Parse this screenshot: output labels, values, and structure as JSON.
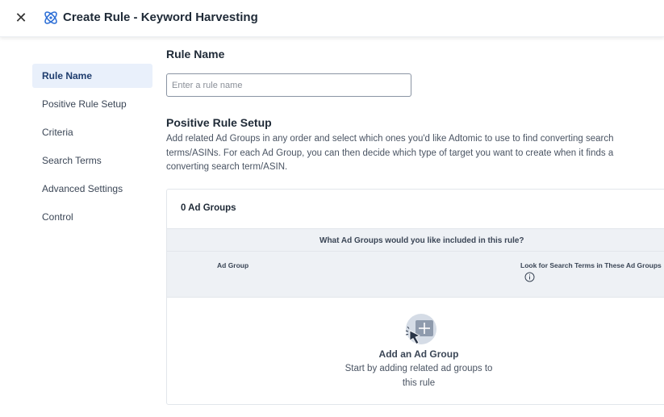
{
  "header": {
    "title": "Create Rule - Keyword Harvesting",
    "close_icon": "close-icon",
    "logo_icon": "adtomic-logo-icon"
  },
  "sidebar": {
    "items": [
      {
        "label": "Rule Name",
        "active": true
      },
      {
        "label": "Positive Rule Setup",
        "active": false
      },
      {
        "label": "Criteria",
        "active": false
      },
      {
        "label": "Search Terms",
        "active": false
      },
      {
        "label": "Advanced Settings",
        "active": false
      },
      {
        "label": "Control",
        "active": false
      }
    ]
  },
  "rule_name": {
    "heading": "Rule Name",
    "input_value": "",
    "placeholder": "Enter a rule name"
  },
  "positive_rule_setup": {
    "heading": "Positive Rule Setup",
    "description": "Add related Ad Groups in any order and select which ones you'd like Adtomic to use to find converting search terms/ASINs. For each Ad Group, you can then decide which type of target you want to create when it finds a converting search term/ASIN.",
    "panel": {
      "count_label": "0 Ad Groups",
      "question": "What Ad Groups would you like included in this rule?",
      "columns": {
        "ad_group": "Ad Group",
        "look_for": "Look for Search Terms in These Ad Groups"
      },
      "empty_state": {
        "icon": "add-cursor-icon",
        "title": "Add an Ad Group",
        "description": "Start by adding related ad groups to this rule"
      }
    }
  },
  "colors": {
    "accent": "#1f3d6e",
    "active_bg": "#e9f0fb",
    "table_header_bg": "#eef1f5",
    "logo_blue": "#2e6fd6"
  }
}
